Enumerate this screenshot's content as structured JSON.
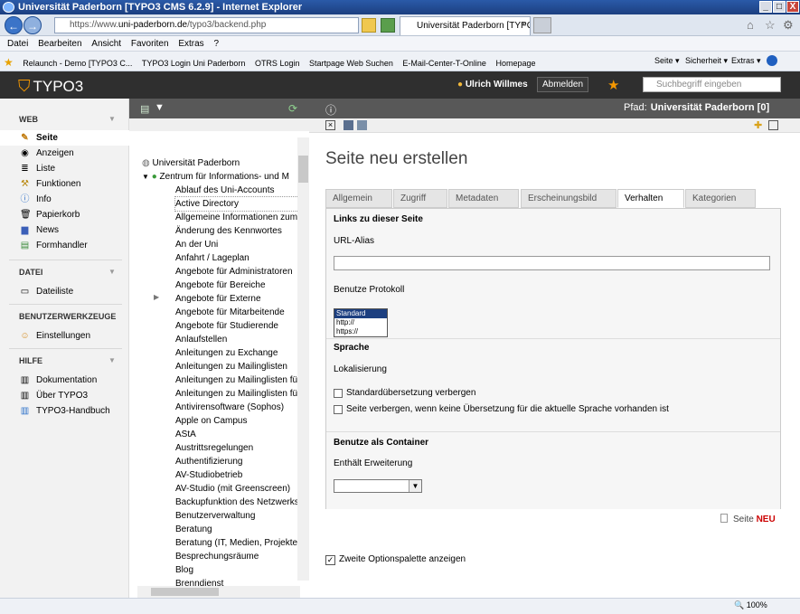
{
  "window": {
    "title": "Universität Paderborn [TYPO3 CMS 6.2.9] - Internet Explorer",
    "min": "_",
    "max": "□",
    "close": "X"
  },
  "browser": {
    "back": "←",
    "forward": "→",
    "url_prefix": "https://www.",
    "url_host": "uni-paderborn.de",
    "url_path": "/typo3/backend.php",
    "tab_label": "Universität Paderborn [TYPO...",
    "tab_close": "×"
  },
  "menu": [
    "Datei",
    "Bearbeiten",
    "Ansicht",
    "Favoriten",
    "Extras",
    "?"
  ],
  "favorites": [
    "Relaunch - Demo [TYPO3 C...",
    "TYPO3 Login Uni Paderborn",
    "OTRS  Login",
    "Startpage Web Suchen",
    "E-Mail-Center-T-Online",
    "Homepage"
  ],
  "ie_tools": [
    "Seite ▾",
    "Sicherheit ▾",
    "Extras ▾"
  ],
  "typo3": {
    "logo": "TYPO3",
    "user": "Ulrich Willmes",
    "logout": "Abmelden",
    "search_placeholder": "Suchbegriff eingeben",
    "path_label": "Pfad:",
    "path_value": "Universität Paderborn [0]"
  },
  "modules": {
    "web": {
      "title": "WEB",
      "items": [
        "Seite",
        "Anzeigen",
        "Liste",
        "Funktionen",
        "Info",
        "Papierkorb",
        "News",
        "Formhandler"
      ]
    },
    "datei": {
      "title": "DATEI",
      "items": [
        "Dateiliste"
      ]
    },
    "tools": {
      "title": "BENUTZERWERKZEUGE",
      "items": [
        "Einstellungen"
      ]
    },
    "hilfe": {
      "title": "HILFE",
      "items": [
        "Dokumentation",
        "Über TYPO3",
        "TYPO3-Handbuch"
      ]
    }
  },
  "tree": {
    "root": "Universität Paderborn",
    "zim": "Zentrum für Informations- und M",
    "pages": [
      "Ablauf des Uni-Accounts",
      "Active Directory",
      "Allgemeine Informationen zum",
      "Änderung des Kennwortes",
      "An der Uni",
      "Anfahrt / Lageplan",
      "Angebote für Administratoren",
      "Angebote für Bereiche",
      "Angebote für Externe",
      "Angebote für Mitarbeitende",
      "Angebote für Studierende",
      "Anlaufstellen",
      "Anleitungen zu Exchange",
      "Anleitungen zu Mailinglisten",
      "Anleitungen zu Mailinglisten fü",
      "Anleitungen zu Mailinglisten fü",
      "Antivirensoftware (Sophos)",
      "Apple on Campus",
      "AStA",
      "Austrittsregelungen",
      "Authentifizierung",
      "AV-Studiobetrieb",
      "AV-Studio (mit Greenscreen)",
      "Backupfunktion des Netzwerks",
      "Benutzerverwaltung",
      "Beratung",
      "Beratung (IT, Medien, Projekte",
      "Besprechungsräume",
      "Blog",
      "Brenndienst"
    ]
  },
  "form": {
    "title": "Seite neu erstellen",
    "tabs": [
      "Allgemein",
      "Zugriff",
      "Metadaten",
      "Erscheinungsbild",
      "Verhalten",
      "Kategorien"
    ],
    "links_heading": "Links zu dieser Seite",
    "url_alias_label": "URL-Alias",
    "protocol_label": "Benutze Protokoll",
    "protocol_options": [
      "Standard",
      "http://",
      "https://"
    ],
    "sprache_heading": "Sprache",
    "lokal_label": "Lokalisierung",
    "cb1": "Standardübersetzung verbergen",
    "cb2": "Seite verbergen, wenn keine Übersetzung für die aktuelle Sprache vorhanden ist",
    "container_heading": "Benutze als Container",
    "ext_label": "Enthält Erweiterung",
    "new_page_prefix": "Seite",
    "new_page_suffix": "NEU",
    "second_palette": "Zweite Optionspalette anzeigen"
  },
  "status": {
    "zoom": "100%"
  }
}
